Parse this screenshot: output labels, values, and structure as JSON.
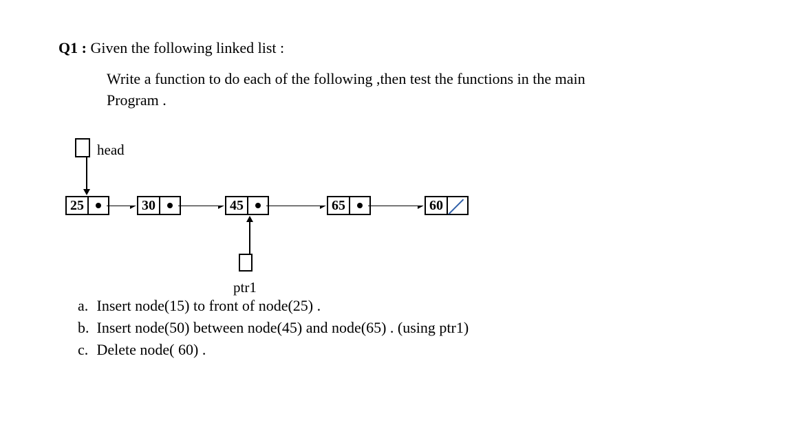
{
  "question": {
    "label": "Q1 :",
    "title": "Given the following linked list :",
    "instruction_line1": "Write a function  to do each of the following ,then test the functions in the main",
    "instruction_line2": "Program ."
  },
  "diagram": {
    "head_label": "head",
    "ptr1_label": "ptr1",
    "nodes": [
      {
        "value": "25"
      },
      {
        "value": "30"
      },
      {
        "value": "45"
      },
      {
        "value": "65"
      },
      {
        "value": "60"
      }
    ]
  },
  "tasks": {
    "a_bullet": "a.",
    "a": "Insert node(15) to front of node(25) .",
    "b_bullet": "b.",
    "b": "Insert node(50) between node(45) and node(65) . (using ptr1)",
    "c_bullet": "c.",
    "c": "Delete node( 60) ."
  }
}
